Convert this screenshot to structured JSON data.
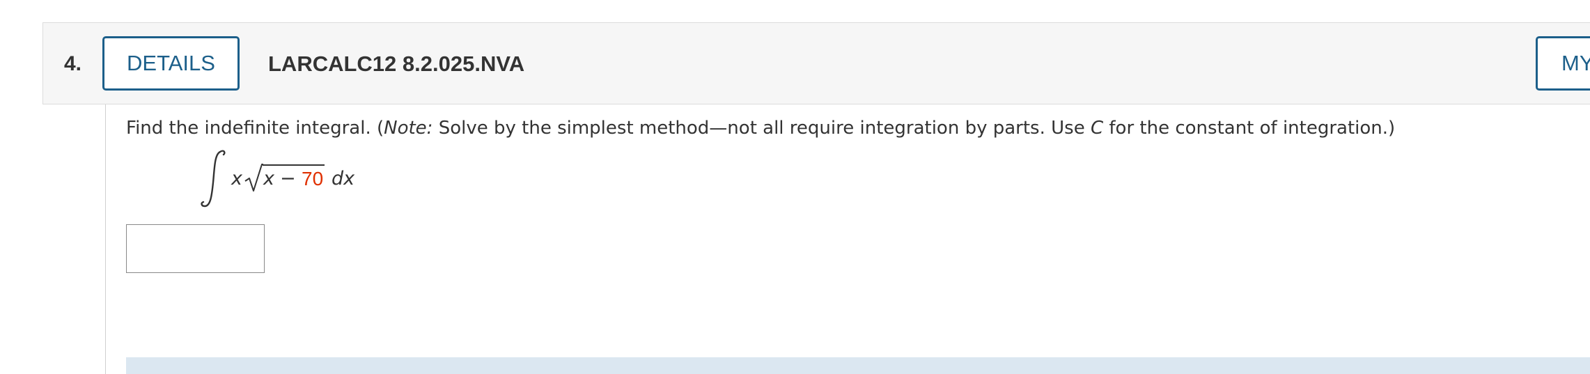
{
  "question": {
    "number": "4.",
    "details_label": "DETAILS",
    "problem_code": "LARCALC12 8.2.025.NVA",
    "my_notes_label": "MY"
  },
  "prompt": {
    "text_before_note": "Find the indefinite integral. (",
    "note_label": "Note:",
    "text_after_note": " Solve by the simplest method—not all require integration by parts. Use ",
    "constant_symbol": "C",
    "text_end": " for the constant of integration.)"
  },
  "integral": {
    "integrand_factor": "x",
    "radicand_var": "x",
    "radicand_op": "−",
    "radicand_value": "70",
    "differential": "dx"
  },
  "answer": {
    "value": ""
  },
  "colors": {
    "accent": "#1c5f8a",
    "highlight_number": "#e03000",
    "info_band": "#dbe7f1"
  }
}
